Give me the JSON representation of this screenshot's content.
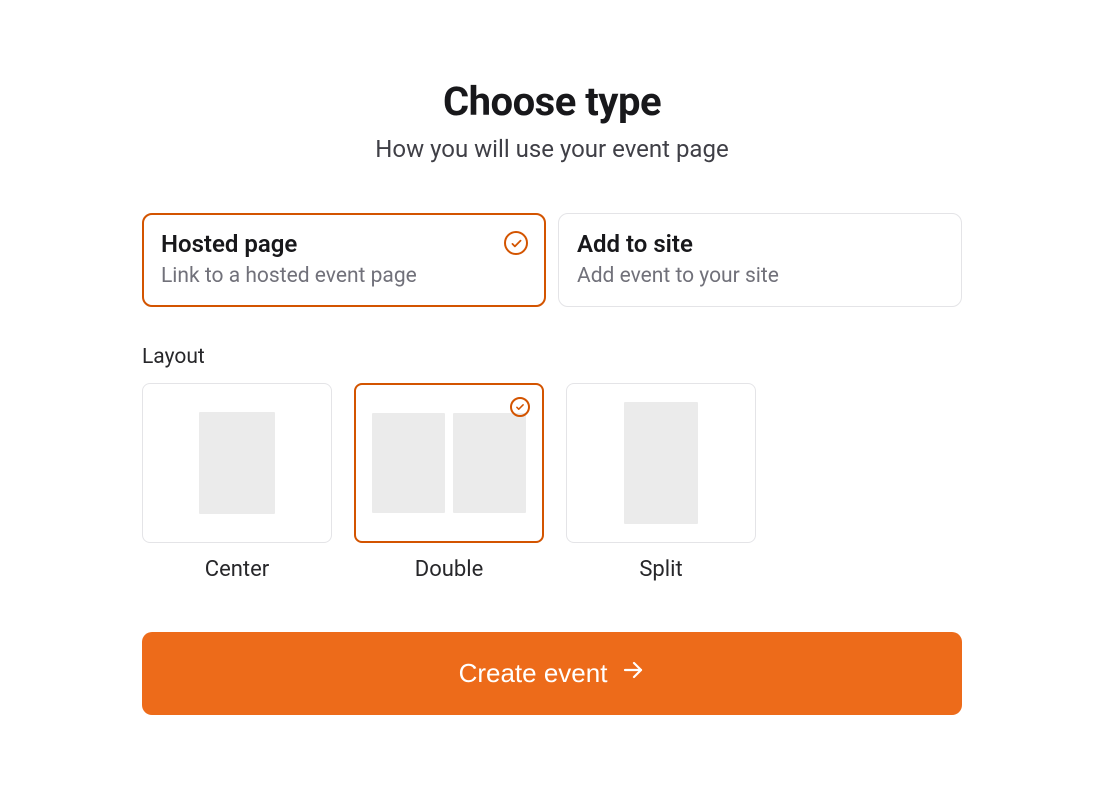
{
  "header": {
    "title": "Choose type",
    "subtitle": "How you will use your event page"
  },
  "typeOptions": {
    "hosted": {
      "title": "Hosted page",
      "desc": "Link to a hosted event page",
      "selected": true
    },
    "addToSite": {
      "title": "Add to site",
      "desc": "Add event to your site",
      "selected": false
    }
  },
  "layout": {
    "label": "Layout",
    "options": {
      "center": {
        "name": "Center",
        "selected": false
      },
      "double": {
        "name": "Double",
        "selected": true
      },
      "split": {
        "name": "Split",
        "selected": false
      }
    }
  },
  "cta": {
    "label": "Create event"
  },
  "colors": {
    "accent": "#d35400",
    "primaryButton": "#ed6b1a"
  }
}
